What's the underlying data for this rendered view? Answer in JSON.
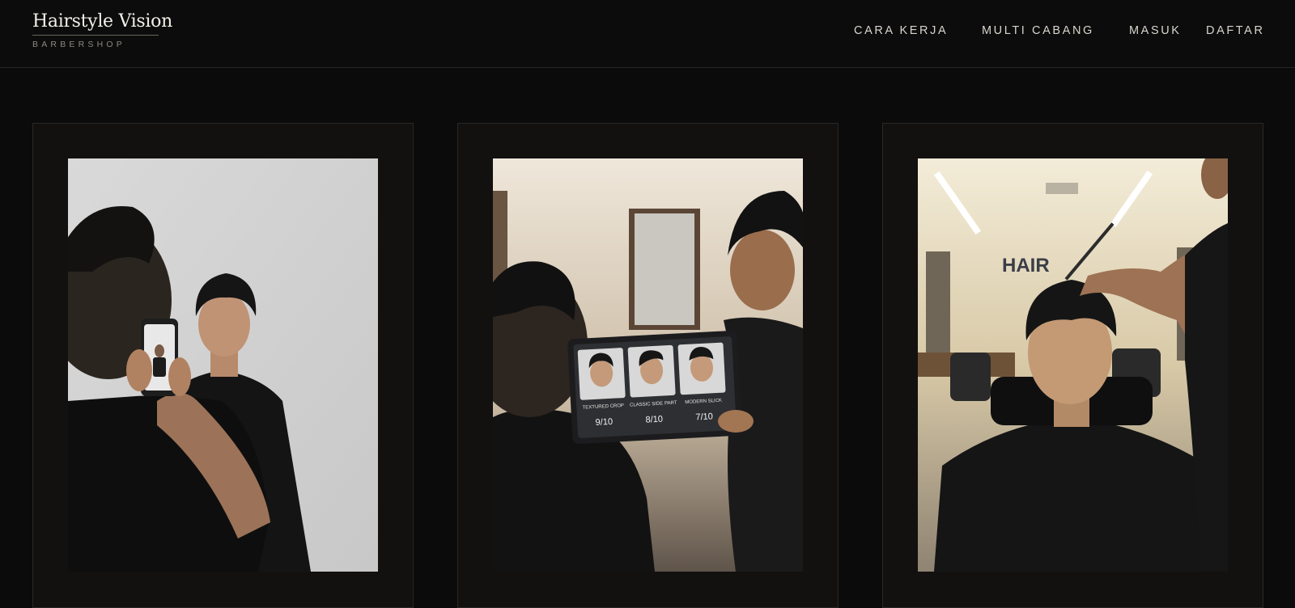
{
  "brand": {
    "title": "Hairstyle Vision",
    "subtitle": "BARBERSHOP"
  },
  "nav": {
    "items": [
      {
        "label": "CARA KERJA"
      },
      {
        "label": "MULTI CABANG"
      },
      {
        "label": "MASUK"
      },
      {
        "label": "DAFTAR"
      }
    ]
  },
  "cards": [
    {
      "image": "photo-man-taking-phone-picture"
    },
    {
      "image": "photo-barber-showing-tablet",
      "tablet": {
        "styles": [
          {
            "name": "TEXTURED CROP",
            "score": "9/10"
          },
          {
            "name": "CLASSIC SIDE PART",
            "score": "8/10"
          },
          {
            "name": "MODERN SLICK",
            "score": "7/10"
          }
        ]
      }
    },
    {
      "image": "photo-barber-cutting-hair",
      "wall_sign": "HAIR"
    }
  ],
  "colors": {
    "background": "#0b0b0b",
    "card": "#121110",
    "text": "#e8e4dc"
  }
}
